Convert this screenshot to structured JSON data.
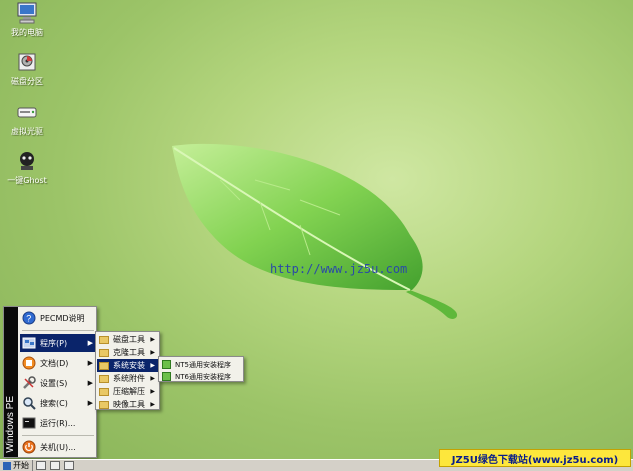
{
  "desktop": {
    "icons": [
      {
        "label": "我的电脑",
        "icon": "computer-icon"
      },
      {
        "label": "磁盘分区",
        "icon": "disk-partition-icon"
      },
      {
        "label": "虚拟光驱",
        "icon": "virtual-drive-icon"
      },
      {
        "label": "一键Ghost",
        "icon": "ghost-icon"
      }
    ],
    "url": "http://www.jz5u.com"
  },
  "start_menu": {
    "side_label": "Windows PE",
    "items": [
      {
        "label": "PECMD说明",
        "icon": "help-icon"
      },
      {
        "label": "程序(P)",
        "icon": "programs-icon",
        "has_submenu": true,
        "active": true
      },
      {
        "label": "文档(D)",
        "icon": "documents-icon",
        "has_submenu": true
      },
      {
        "label": "设置(S)",
        "icon": "settings-icon",
        "has_submenu": true
      },
      {
        "label": "搜索(C)",
        "icon": "search-icon",
        "has_submenu": true
      },
      {
        "label": "运行(R)...",
        "icon": "run-icon"
      },
      {
        "label": "关机(U)...",
        "icon": "shutdown-icon"
      }
    ]
  },
  "programs_menu": {
    "items": [
      {
        "label": "磁盘工具",
        "has_submenu": true
      },
      {
        "label": "克隆工具",
        "has_submenu": true
      },
      {
        "label": "系统安装",
        "has_submenu": true,
        "active": true
      },
      {
        "label": "系统附件",
        "has_submenu": true
      },
      {
        "label": "压缩解压",
        "has_submenu": true
      },
      {
        "label": "映像工具",
        "has_submenu": true
      }
    ]
  },
  "install_menu": {
    "items": [
      {
        "label": "NT5通用安装程序",
        "icon": "installer-icon"
      },
      {
        "label": "NT6通用安装程序",
        "icon": "installer-icon"
      }
    ]
  },
  "taskbar": {
    "start_label": "开始"
  },
  "watermark": "JZ5U绿色下载站(www.jz5u.com)"
}
